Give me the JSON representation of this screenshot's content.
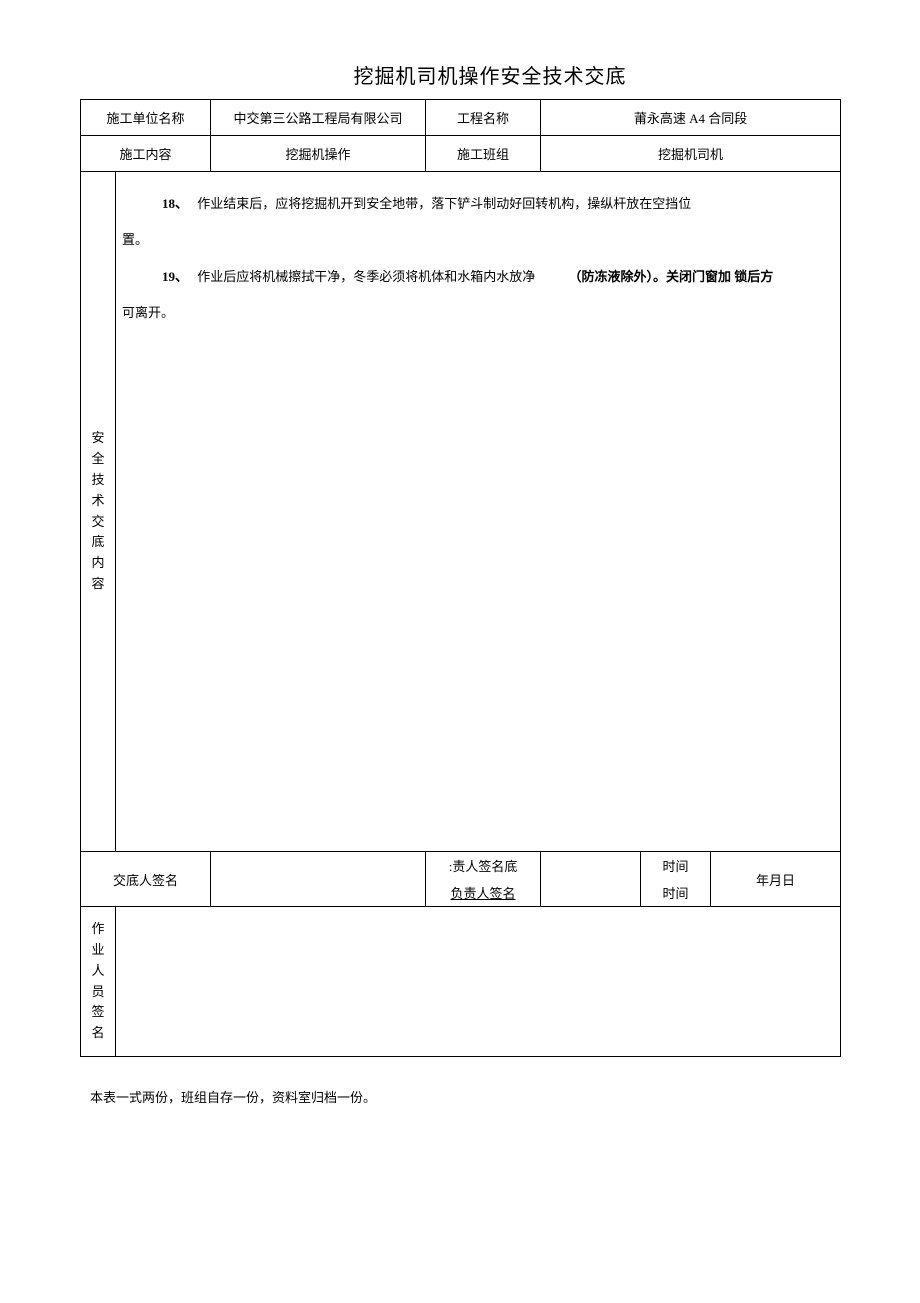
{
  "title": "挖掘机司机操作安全技术交底",
  "header": {
    "row1": {
      "label1": "施工单位名称",
      "value1": "中交第三公路工程局有限公司",
      "label2": "工程名称",
      "value2": "莆永高速 A4 合同段"
    },
    "row2": {
      "label1": "施工内容",
      "value1": "挖掘机操作",
      "label2": "施工班组",
      "value2": "挖掘机司机"
    }
  },
  "sidebar_label": "安 全 技 术 交 底 内 容",
  "content": {
    "item18_num": "18、",
    "item18_text": "作业结束后，应将挖掘机开到安全地带，落下铲斗制动好回转机构，操纵杆放在空挡位",
    "item18_cont": "置。",
    "item19_num": "19、",
    "item19_text1": "作业后应将机械擦拭干净，冬季必须将机体和水箱内水放净",
    "item19_text2": "（防冻液除外）。关闭门窗加 锁后方",
    "item19_cont": "可离开。"
  },
  "sign": {
    "label1": "交底人签名",
    "label2": ":责人签名底",
    "label2b": "负责人签名",
    "label3": "时间",
    "label3b": "时间",
    "date": "年月日"
  },
  "worker_label": "作 业 人 员 签 名",
  "footer": "本表一式两份，班组自存一份，资料室归档一份。"
}
